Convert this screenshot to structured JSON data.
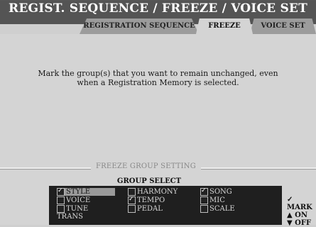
{
  "title": "REGIST. SEQUENCE / FREEZE / VOICE SET",
  "tabs": [
    "REGISTRATION SEQUENCE",
    "FREEZE",
    "VOICE SET"
  ],
  "message": "Mark the group(s) that you want to remain unchanged, even when a Registration Memory is selected.",
  "section_label": "FREEZE GROUP SETTING",
  "group_select_label": "GROUP SELECT",
  "groups": [
    {
      "label": "STYLE",
      "checked": true,
      "selected": true
    },
    {
      "label": "HARMONY",
      "checked": false,
      "selected": false
    },
    {
      "label": "SONG",
      "checked": true,
      "selected": false
    },
    {
      "label": "VOICE",
      "checked": false,
      "selected": false
    },
    {
      "label": "TEMPO",
      "checked": true,
      "selected": false
    },
    {
      "label": "MIC",
      "checked": false,
      "selected": false
    },
    {
      "label": "TUNE TRANS",
      "checked": false,
      "selected": false
    },
    {
      "label": "PEDAL",
      "checked": false,
      "selected": false
    },
    {
      "label": "SCALE",
      "checked": false,
      "selected": false
    }
  ],
  "legend": {
    "mark": "✓ MARK",
    "on": "▲ ON",
    "off": "▼ OFF"
  }
}
